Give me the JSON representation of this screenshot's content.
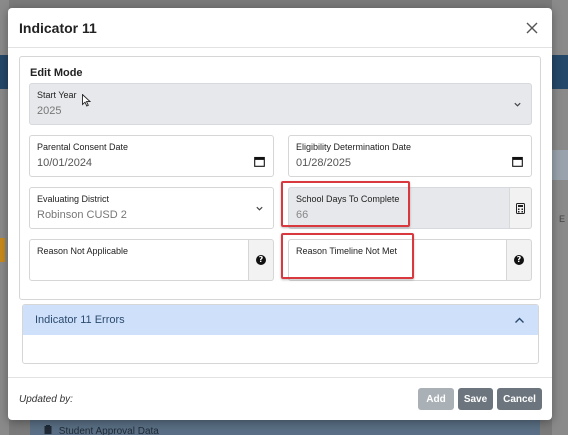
{
  "modal": {
    "title": "Indicator 11",
    "edit_mode_label": "Edit Mode"
  },
  "fields": {
    "start_year": {
      "label": "Start Year",
      "value": "2025"
    },
    "parental_consent_date": {
      "label": "Parental Consent Date",
      "value": "10/01/2024"
    },
    "eligibility_determination_date": {
      "label": "Eligibility Determination Date",
      "value": "01/28/2025"
    },
    "evaluating_district": {
      "label": "Evaluating District",
      "value": "Robinson CUSD 2"
    },
    "school_days_to_complete": {
      "label": "School Days To Complete",
      "value": "66"
    },
    "reason_not_applicable": {
      "label": "Reason Not Applicable",
      "value": ""
    },
    "reason_timeline_not_met": {
      "label": "Reason Timeline Not Met",
      "value": ""
    }
  },
  "errors_panel": {
    "title": "Indicator 11 Errors"
  },
  "footer": {
    "updated_by": "Updated by:",
    "add_label": "Add",
    "save_label": "Save",
    "cancel_label": "Cancel"
  },
  "background": {
    "bottom_bar_text": "Student Approval Data",
    "right_text": "E"
  },
  "colors": {
    "highlight": "#d9383f",
    "errors_header_bg": "#cfe1fa",
    "button_gray": "#6c757d",
    "button_disabled": "#a9b0b6"
  },
  "icons": {
    "close": "close-icon",
    "dropdown": "chevron-down-icon",
    "calendar": "calendar-icon",
    "calculator": "calculator-icon",
    "help": "question-circle-icon",
    "collapse": "chevron-up-icon"
  }
}
